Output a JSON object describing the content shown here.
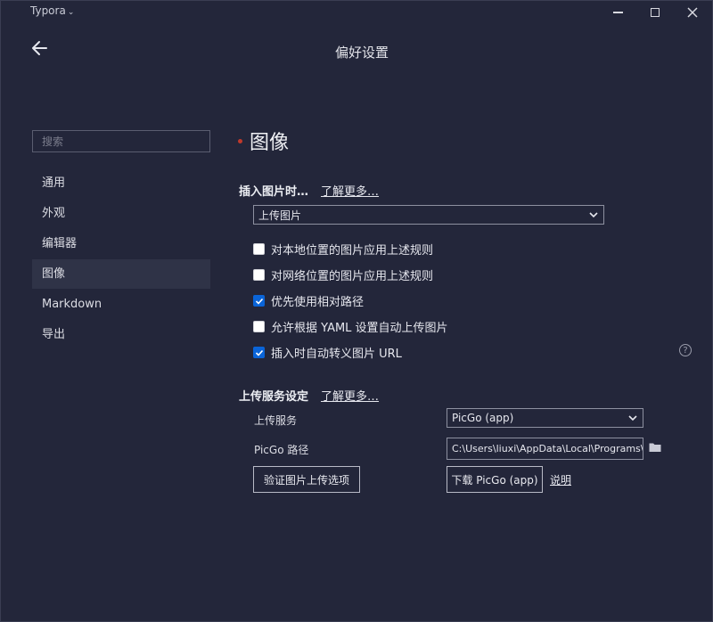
{
  "window": {
    "app_title": "Typora",
    "app_title_caret": "⌄"
  },
  "header": {
    "title": "偏好设置"
  },
  "sidebar": {
    "search_placeholder": "搜索",
    "items": [
      {
        "label": "通用",
        "active": false
      },
      {
        "label": "外观",
        "active": false
      },
      {
        "label": "编辑器",
        "active": false
      },
      {
        "label": "图像",
        "active": true
      },
      {
        "label": "Markdown",
        "active": false
      },
      {
        "label": "导出",
        "active": false
      }
    ]
  },
  "main": {
    "section_title": "图像",
    "insert": {
      "label": "插入图片时…",
      "learn_more": "了解更多…",
      "selected": "上传图片"
    },
    "options": [
      {
        "label": "对本地位置的图片应用上述规则",
        "checked": false
      },
      {
        "label": "对网络位置的图片应用上述规则",
        "checked": false
      },
      {
        "label": "优先使用相对路径",
        "checked": true
      },
      {
        "label": "允许根据 YAML 设置自动上传图片",
        "checked": false
      },
      {
        "label": "插入时自动转义图片 URL",
        "checked": true
      }
    ],
    "help_icon": "?",
    "upload": {
      "label": "上传服务设定",
      "learn_more": "了解更多…",
      "service_label": "上传服务",
      "service_selected": "PicGo (app)",
      "path_label": "PicGo 路径",
      "path_value": "C:\\Users\\liuxi\\AppData\\Local\\Programs\\PicGo\\PicGo.exe",
      "verify_button": "验证图片上传选项",
      "download_button": "下载 PicGo (app)",
      "explain_link": "说明"
    }
  },
  "colors": {
    "background": "#23263a",
    "active_nav": "#2f3347",
    "checkbox_checked": "#0a64d8",
    "section_dot": "#c0392b"
  }
}
